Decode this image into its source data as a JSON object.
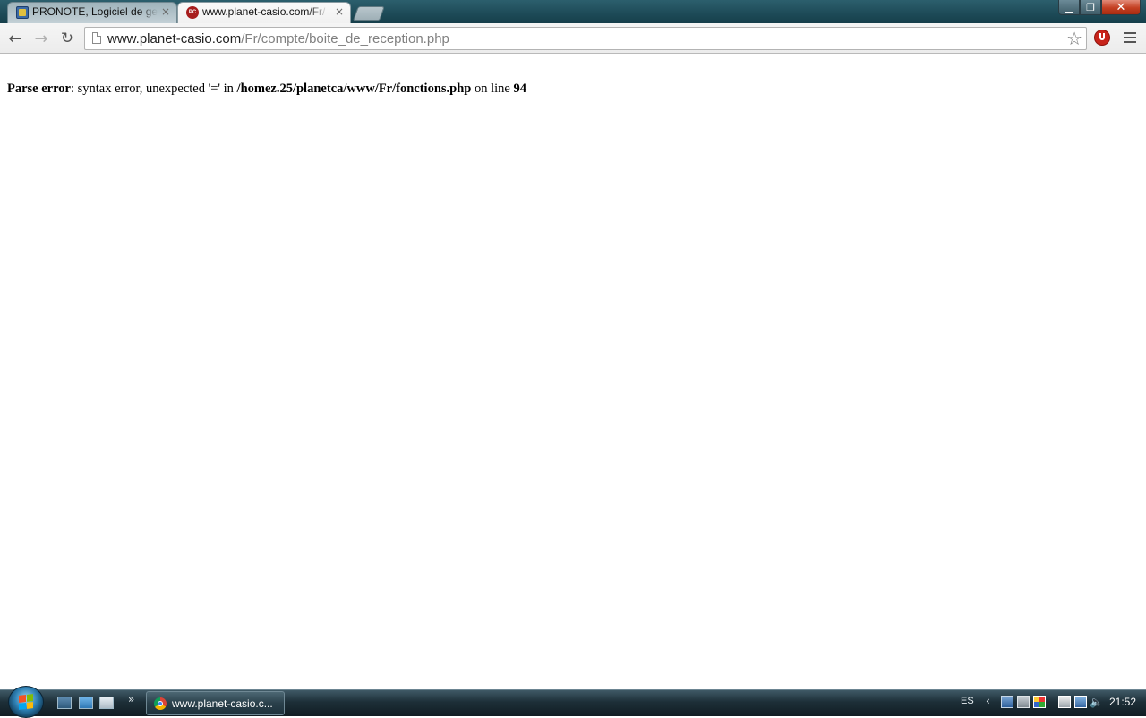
{
  "browser": {
    "tabs": [
      {
        "title": "PRONOTE, Logiciel de gest",
        "close": "×",
        "active": false
      },
      {
        "title": "www.planet-casio.com/Fr/",
        "close": "×",
        "active": true,
        "favicon_text": "PC"
      }
    ],
    "window_controls": {
      "minimize": "▁",
      "maximize": "❐",
      "close": "✕"
    },
    "toolbar": {
      "back": "←",
      "forward": "→",
      "reload": "↻"
    },
    "address_bar": {
      "host": "www.planet-casio.com",
      "path": "/Fr/compte/boite_de_reception.php"
    },
    "bookmark_star": "☆"
  },
  "page": {
    "error": {
      "label": "Parse error",
      "message": ": syntax error, unexpected '=' in ",
      "file": "/homez.25/planetca/www/Fr/fonctions.php",
      "on_line_text": " on line ",
      "line": "94"
    }
  },
  "taskbar": {
    "quick_launch_more": "»",
    "window_button_label": "www.planet-casio.c...",
    "language": "ES",
    "tray_expand": "‹",
    "volume_icon": "🔈",
    "clock": "21:52"
  },
  "colors": {
    "titlebar": "#1d4a57",
    "taskbar": "#1d2f38",
    "close_button": "#c43f22",
    "url_path": "#808080"
  },
  "icons": [
    "page-icon",
    "star-icon",
    "stop-extension-icon",
    "menu-icon",
    "windows-start-icon",
    "chrome-icon"
  ]
}
